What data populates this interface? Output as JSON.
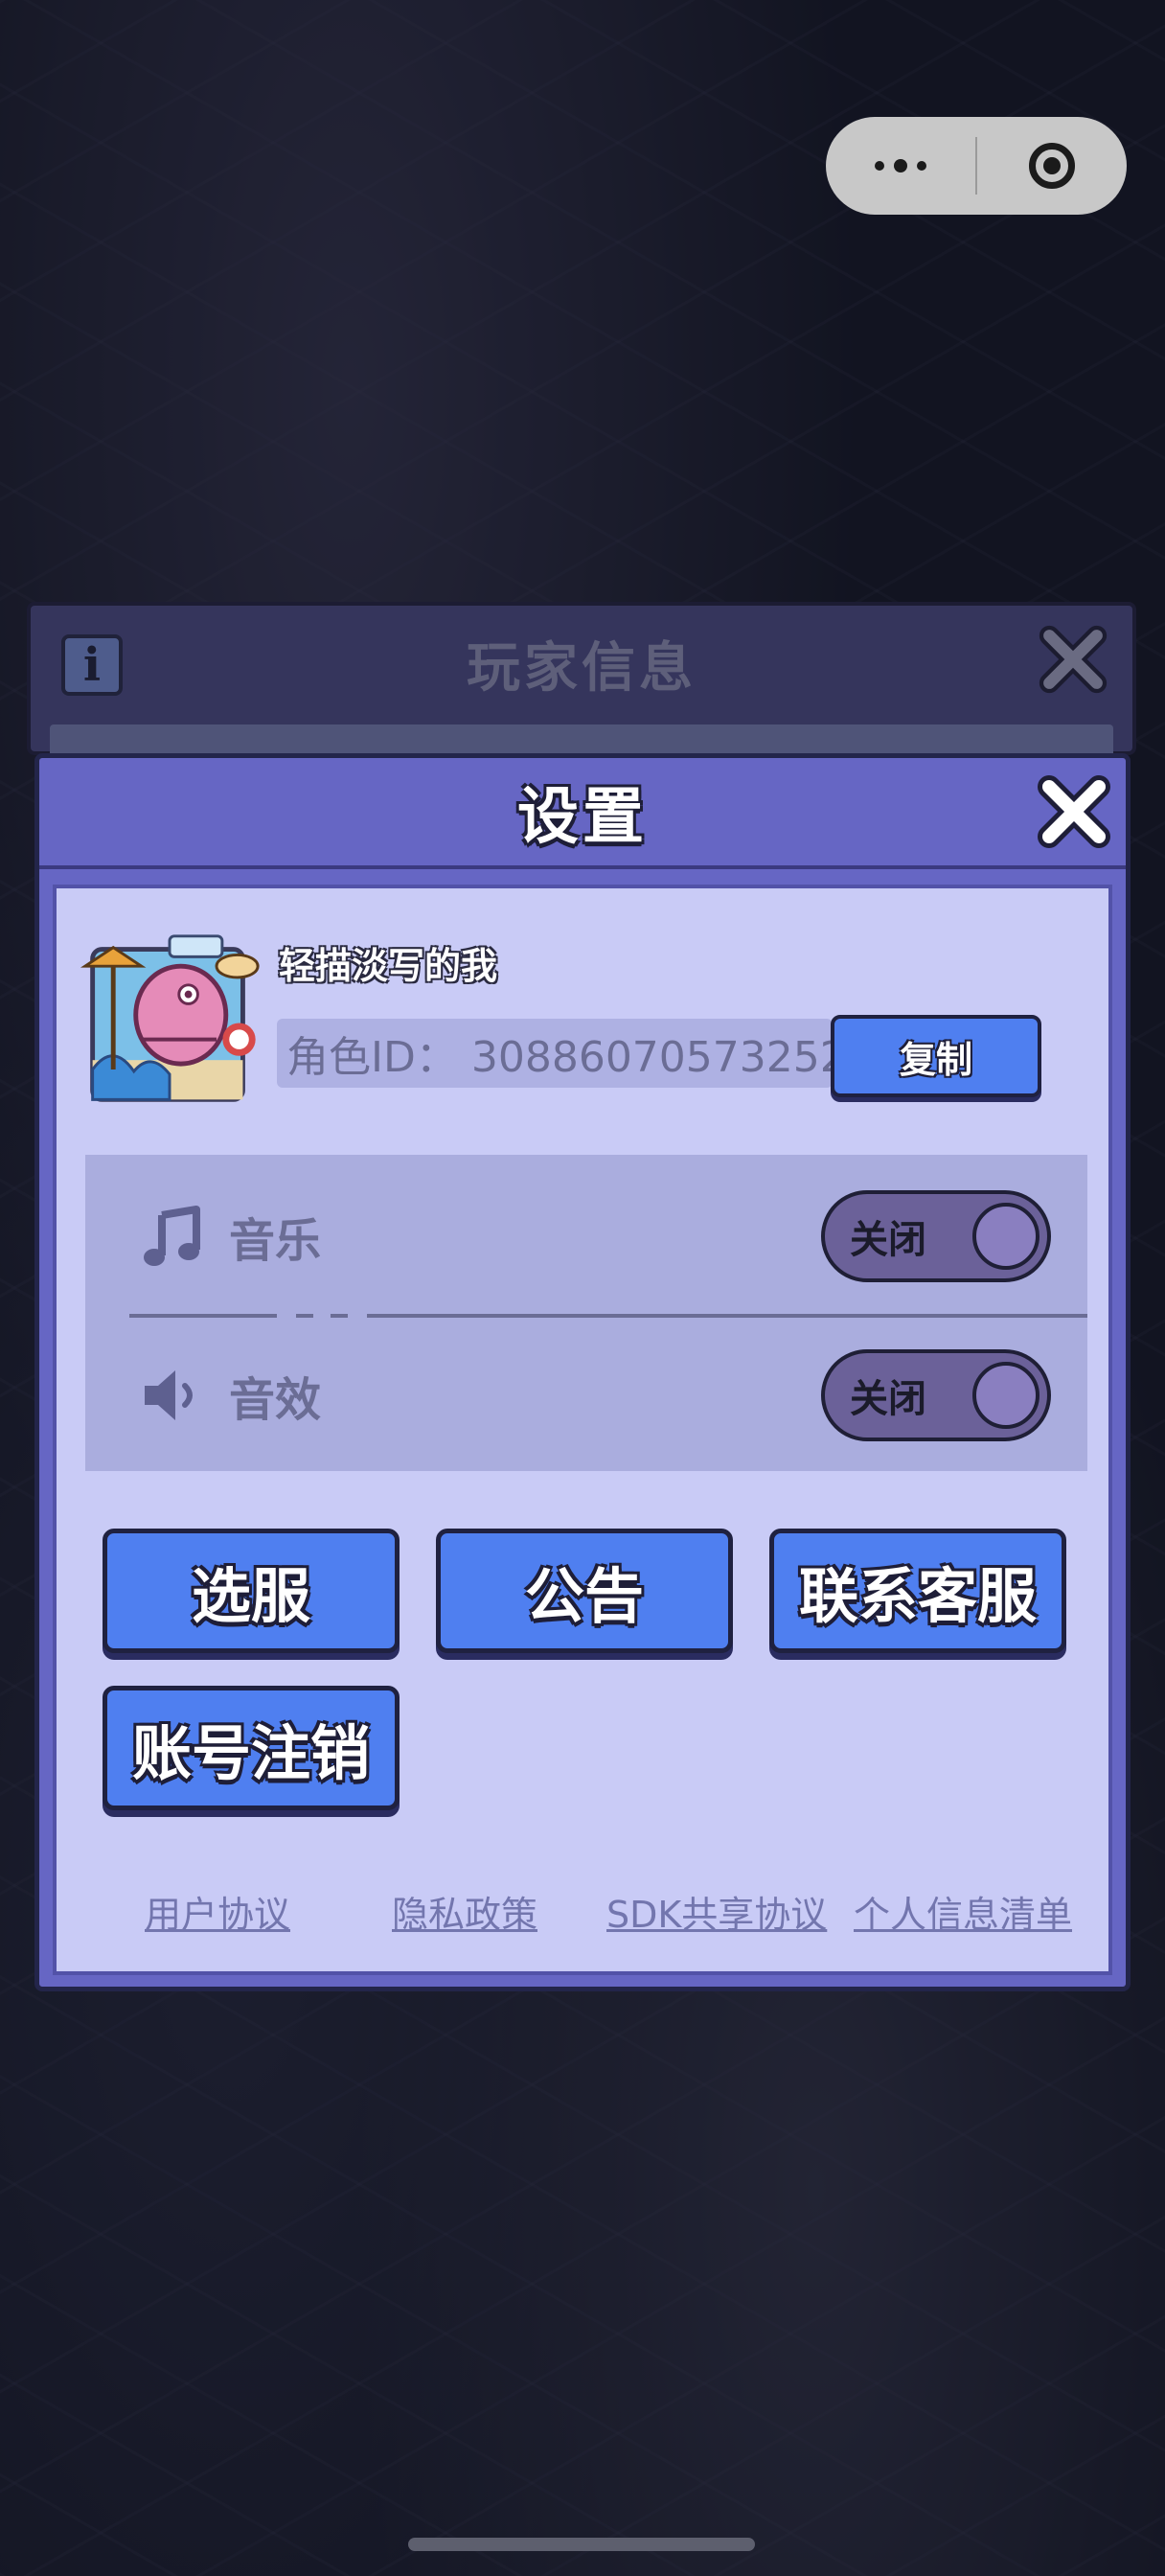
{
  "capsule": {
    "more_icon": "more-dots-icon",
    "close_icon": "target-circle-icon"
  },
  "player_info": {
    "title": "玩家信息",
    "info_icon_text": "i"
  },
  "settings": {
    "title": "设置",
    "username": "轻描淡写的我",
    "role_id": "角色ID： 30886070573252",
    "copy_label": "复制",
    "audio": [
      {
        "icon": "music-note-icon",
        "label": "音乐",
        "toggle_label": "关闭"
      },
      {
        "icon": "speaker-icon",
        "label": "音效",
        "toggle_label": "关闭"
      }
    ],
    "buttons": {
      "select_server": "选服",
      "announcement": "公告",
      "customer_service": "联系客服",
      "account_cancel": "账号注销"
    },
    "links": {
      "user_agreement": "用户协议",
      "privacy_policy": "隐私政策",
      "sdk_agreement": "SDK共享协议",
      "personal_info": "个人信息清单"
    }
  },
  "colors": {
    "dialog_header": "#6666c4",
    "dialog_body": "#c9cbf6",
    "button_blue": "#4f7ff0",
    "toggle_off": "#6b6199"
  }
}
